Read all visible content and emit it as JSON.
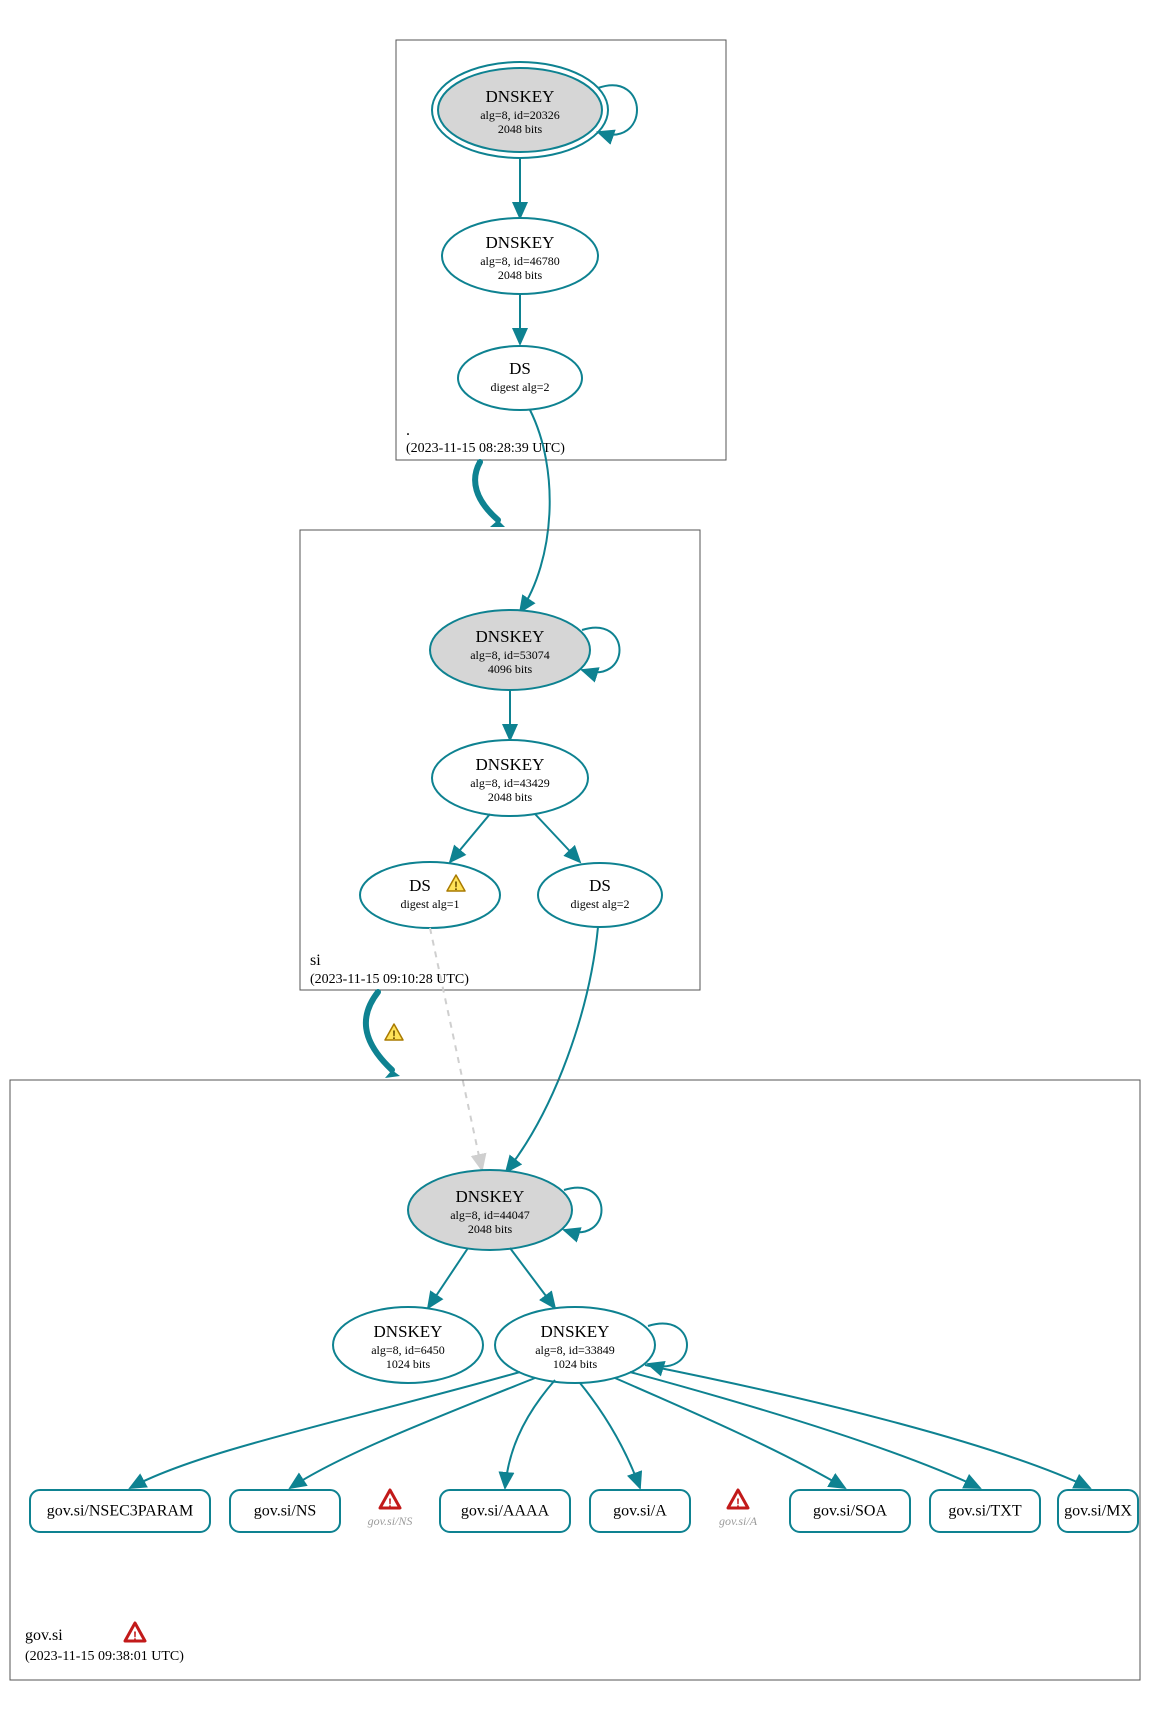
{
  "zones": {
    "root": {
      "label": ".",
      "timestamp": "(2023-11-15 08:28:39 UTC)"
    },
    "si": {
      "label": "si",
      "timestamp": "(2023-11-15 09:10:28 UTC)"
    },
    "gov": {
      "label": "gov.si",
      "timestamp": "(2023-11-15 09:38:01 UTC)"
    }
  },
  "nodes": {
    "root_key1": {
      "title": "DNSKEY",
      "alg": "alg=8, id=20326",
      "bits": "2048 bits"
    },
    "root_key2": {
      "title": "DNSKEY",
      "alg": "alg=8, id=46780",
      "bits": "2048 bits"
    },
    "root_ds": {
      "title": "DS",
      "alg": "digest alg=2"
    },
    "si_key1": {
      "title": "DNSKEY",
      "alg": "alg=8, id=53074",
      "bits": "4096 bits"
    },
    "si_key2": {
      "title": "DNSKEY",
      "alg": "alg=8, id=43429",
      "bits": "2048 bits"
    },
    "si_ds1": {
      "title": "DS",
      "alg": "digest alg=1"
    },
    "si_ds2": {
      "title": "DS",
      "alg": "digest alg=2"
    },
    "gov_key1": {
      "title": "DNSKEY",
      "alg": "alg=8, id=44047",
      "bits": "2048 bits"
    },
    "gov_key2": {
      "title": "DNSKEY",
      "alg": "alg=8, id=6450",
      "bits": "1024 bits"
    },
    "gov_key3": {
      "title": "DNSKEY",
      "alg": "alg=8, id=33849",
      "bits": "1024 bits"
    }
  },
  "rr": {
    "r1": "gov.si/NSEC3PARAM",
    "r2": "gov.si/NS",
    "r3": "gov.si/AAAA",
    "r4": "gov.si/A",
    "r5": "gov.si/SOA",
    "r6": "gov.si/TXT",
    "r7": "gov.si/MX",
    "e1": "gov.si/NS",
    "e2": "gov.si/A"
  }
}
